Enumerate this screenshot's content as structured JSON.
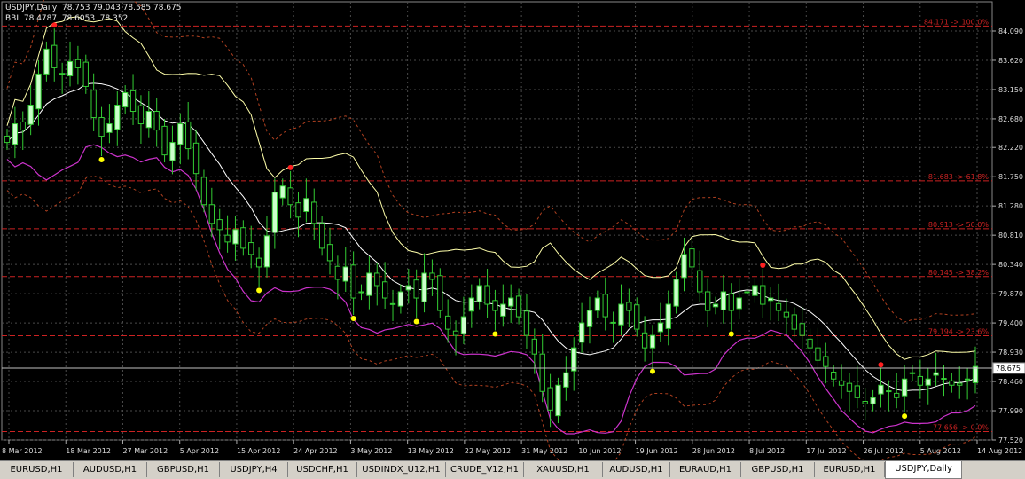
{
  "chart_info": {
    "symbol_line": "USDJPY,Daily  78.753 79.043 78.585 78.675",
    "indicator_line": "BBI: 78.4787  78.6053  78.352"
  },
  "chart_data": {
    "type": "candlestick",
    "price_axis": {
      "ticks": [
        "84.090",
        "83.620",
        "83.150",
        "82.680",
        "82.220",
        "81.750",
        "81.280",
        "80.810",
        "80.340",
        "79.870",
        "79.400",
        "78.930",
        "78.460",
        "77.990",
        "77.520"
      ],
      "min": 77.52,
      "max": 84.09
    },
    "current_price": "78.675",
    "date_axis": [
      "8 Mar 2012",
      "18 Mar 2012",
      "27 Mar 2012",
      "5 Apr 2012",
      "15 Apr 2012",
      "24 Apr 2012",
      "3 May 2012",
      "13 May 2012",
      "22 May 2012",
      "31 May 2012",
      "10 Jun 2012",
      "19 Jun 2012",
      "28 Jun 2012",
      "8 Jul 2012",
      "17 Jul 2012",
      "26 Jul 2012",
      "5 Aug 2012",
      "14 Aug 2012"
    ],
    "fib_levels": [
      {
        "label": "84.171 -> 100.0%",
        "price": 84.171
      },
      {
        "label": "81.683 -> 61.8%",
        "price": 81.683
      },
      {
        "label": "80.913 -> 50.0%",
        "price": 80.913
      },
      {
        "label": "80.145 -> 38.2%",
        "price": 80.145
      },
      {
        "label": "79.194 -> 23.6%",
        "price": 79.194
      },
      {
        "label": "77.656 -> 0.0%",
        "price": 77.656
      }
    ],
    "close_series": [
      82.3,
      82.6,
      82.5,
      82.9,
      83.4,
      83.8,
      83.5,
      83.4,
      83.6,
      83.5,
      83.2,
      82.7,
      82.4,
      82.6,
      82.9,
      83.1,
      82.8,
      82.6,
      82.8,
      82.5,
      82.1,
      82.3,
      82.6,
      82.2,
      81.8,
      81.3,
      81.0,
      80.9,
      80.7,
      80.9,
      80.6,
      80.5,
      80.3,
      80.8,
      81.5,
      81.6,
      81.3,
      81.1,
      81.4,
      81.0,
      80.6,
      80.4,
      80.1,
      80.3,
      79.8,
      79.9,
      80.2,
      80.0,
      79.8,
      79.7,
      79.9,
      80.0,
      79.8,
      80.2,
      80.1,
      79.6,
      79.3,
      79.2,
      79.5,
      79.8,
      80.0,
      79.7,
      79.6,
      79.7,
      79.8,
      79.5,
      79.2,
      78.9,
      78.3,
      78.0,
      78.4,
      78.6,
      79.0,
      79.4,
      79.6,
      79.8,
      79.5,
      79.4,
      79.7,
      79.6,
      79.3,
      79.0,
      79.2,
      79.4,
      79.7,
      80.1,
      80.5,
      80.3,
      79.9,
      79.6,
      79.7,
      79.9,
      79.6,
      79.8,
      79.9,
      80.0,
      79.7,
      79.8,
      79.6,
      79.5,
      79.3,
      79.2,
      79.0,
      78.8,
      78.7,
      78.5,
      78.4,
      78.3,
      78.2,
      78.1,
      78.2,
      78.4,
      78.3,
      78.2,
      78.5,
      78.6,
      78.4,
      78.5,
      78.6,
      78.5,
      78.4,
      78.4,
      78.5,
      78.7
    ]
  },
  "tabs": [
    {
      "label": "EURUSD,H1",
      "active": false
    },
    {
      "label": "AUDUSD,H1",
      "active": false
    },
    {
      "label": "GBPUSD,H1",
      "active": false
    },
    {
      "label": "USDJPY,H4",
      "active": false
    },
    {
      "label": "USDCHF,H1",
      "active": false
    },
    {
      "label": "USDINDX_U12,H1",
      "active": false
    },
    {
      "label": "CRUDE_V12,H1",
      "active": false
    },
    {
      "label": "XAUUSD,H1",
      "active": false
    },
    {
      "label": "AUDUSD,H1",
      "active": false
    },
    {
      "label": "EURAUD,H1",
      "active": false
    },
    {
      "label": "GBPUSD,H1",
      "active": false
    },
    {
      "label": "EURUSD,H1",
      "active": false
    },
    {
      "label": "USDJPY,Daily",
      "active": true
    }
  ],
  "colors": {
    "bull": "#ccffcc",
    "bear": "#000000",
    "wick": "#33cc33",
    "grid": "#4a4a4a",
    "fib": "#cc2222",
    "upper_band": "#ffffaa",
    "mid_band": "#ffffff",
    "lower_band": "#cc33cc",
    "dot_red": "#ff2020",
    "dot_yellow": "#ffff00"
  }
}
